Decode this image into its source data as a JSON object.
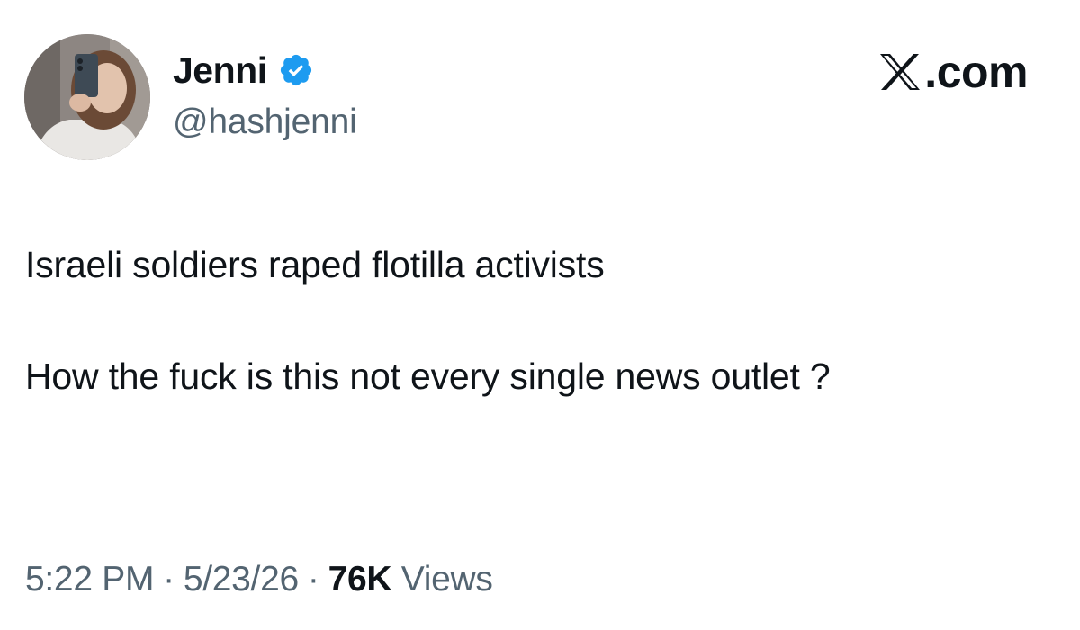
{
  "author": {
    "display_name": "Jenni",
    "handle": "@hashjenni",
    "verified": true,
    "verified_icon": "verified-badge-icon",
    "verified_color": "#1d9bf0"
  },
  "brand": {
    "logo_icon": "x-logo-icon",
    "domain": ".com"
  },
  "tweet": {
    "paragraphs": [
      "Israeli soldiers raped flotilla activists",
      "How the fuck is this not every single news outlet ?"
    ]
  },
  "meta": {
    "time": "5:22 PM",
    "separator": "·",
    "date": "5/23/26",
    "views_count": "76K",
    "views_label": "Views"
  },
  "colors": {
    "text_primary": "#0f1419",
    "text_secondary": "#536471",
    "background": "#ffffff"
  }
}
